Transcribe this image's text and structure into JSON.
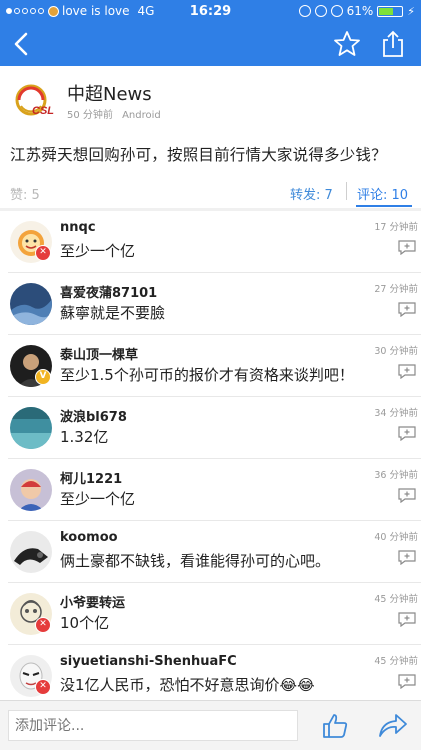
{
  "status": {
    "carrier": "love is love",
    "network": "4G",
    "time": "16:29",
    "battery": "61%",
    "battery_level": 0.61
  },
  "post": {
    "author": "中超News",
    "time": "50 分钟前",
    "source": "Android",
    "question": "江苏舜天想回购孙可，按照目前行情大家说得多少钱？",
    "likes_label": "赞: 5",
    "reposts_label": "转发: 7",
    "comments_label": "评论: 10"
  },
  "comments": [
    {
      "user": "nnqc",
      "text": "至少一个亿",
      "time": "17 分钟前",
      "badge": "red"
    },
    {
      "user": "喜爱夜蒲87101",
      "text": "蘇寧就是不要臉",
      "time": "27 分钟前",
      "badge": ""
    },
    {
      "user": "泰山顶一棵草",
      "text": "至少1.5个孙可币的报价才有资格来谈判吧！",
      "time": "30 分钟前",
      "badge": "gold"
    },
    {
      "user": "波浪bl678",
      "text": "1.32亿",
      "time": "34 分钟前",
      "badge": ""
    },
    {
      "user": "柯儿1221",
      "text": "至少一个亿",
      "time": "36 分钟前",
      "badge": ""
    },
    {
      "user": "koomoo",
      "text": "俩土豪都不缺钱，看谁能得孙可的心吧。",
      "time": "40 分钟前",
      "badge": ""
    },
    {
      "user": "小爷要转运",
      "text": "10个亿",
      "time": "45 分钟前",
      "badge": "red"
    },
    {
      "user": "siyuetianshi-ShenhuaFC",
      "text": "没1亿人民币，恐怕不好意思询价😂😂",
      "time": "45 分钟前",
      "badge": "red"
    }
  ],
  "composer": {
    "placeholder": "添加评论..."
  },
  "colors": {
    "accent": "#2f7fe6",
    "badge_red": "#e53c3c",
    "badge_gold": "#f1b422"
  }
}
